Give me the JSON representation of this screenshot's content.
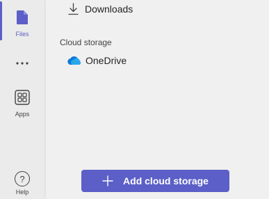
{
  "rail": {
    "files_label": "Files",
    "apps_label": "Apps",
    "help_label": "Help",
    "help_glyph": "?"
  },
  "panel": {
    "downloads_label": "Downloads",
    "cloud_section_label": "Cloud storage",
    "onedrive_label": "OneDrive",
    "add_button_label": "Add cloud storage"
  },
  "colors": {
    "accent": "#5b5fc7",
    "onedrive_blue": "#0f78d4"
  }
}
